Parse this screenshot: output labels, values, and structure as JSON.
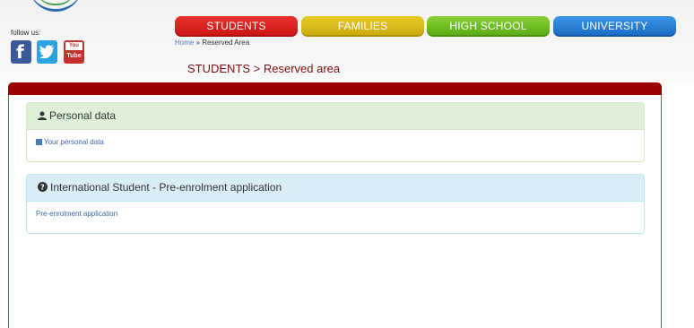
{
  "header": {
    "follow_label": "follow us:",
    "social": [
      {
        "name": "facebook",
        "glyph": "f"
      },
      {
        "name": "twitter"
      },
      {
        "name": "youtube",
        "top": "You",
        "bottom": "Tube"
      }
    ]
  },
  "nav": {
    "tabs": [
      {
        "label": "STUDENTS",
        "color": "#d61e1c"
      },
      {
        "label": "FAMILIES",
        "color": "#d4b519"
      },
      {
        "label": "HIGH SCHOOL",
        "color": "#6cbd22"
      },
      {
        "label": "UNIVERSITY",
        "color": "#2a7fd6"
      }
    ]
  },
  "breadcrumb": {
    "home": "Home",
    "separator": "»",
    "current": "Reserved Area"
  },
  "page": {
    "title": "STUDENTS > Reserved area"
  },
  "sections": [
    {
      "heading": "Personal data",
      "icon": "user-icon",
      "link": "Your personal data",
      "link_icon": "list-icon"
    },
    {
      "heading": "International Student - Pre-enrolment application",
      "icon": "question-circle-icon",
      "link": "Pre-enrolment application"
    }
  ],
  "colors": {
    "panel_top": "#9a0000",
    "success_bg": "#dff0d8",
    "info_bg": "#d9edf7",
    "link": "#3a6aa8"
  }
}
